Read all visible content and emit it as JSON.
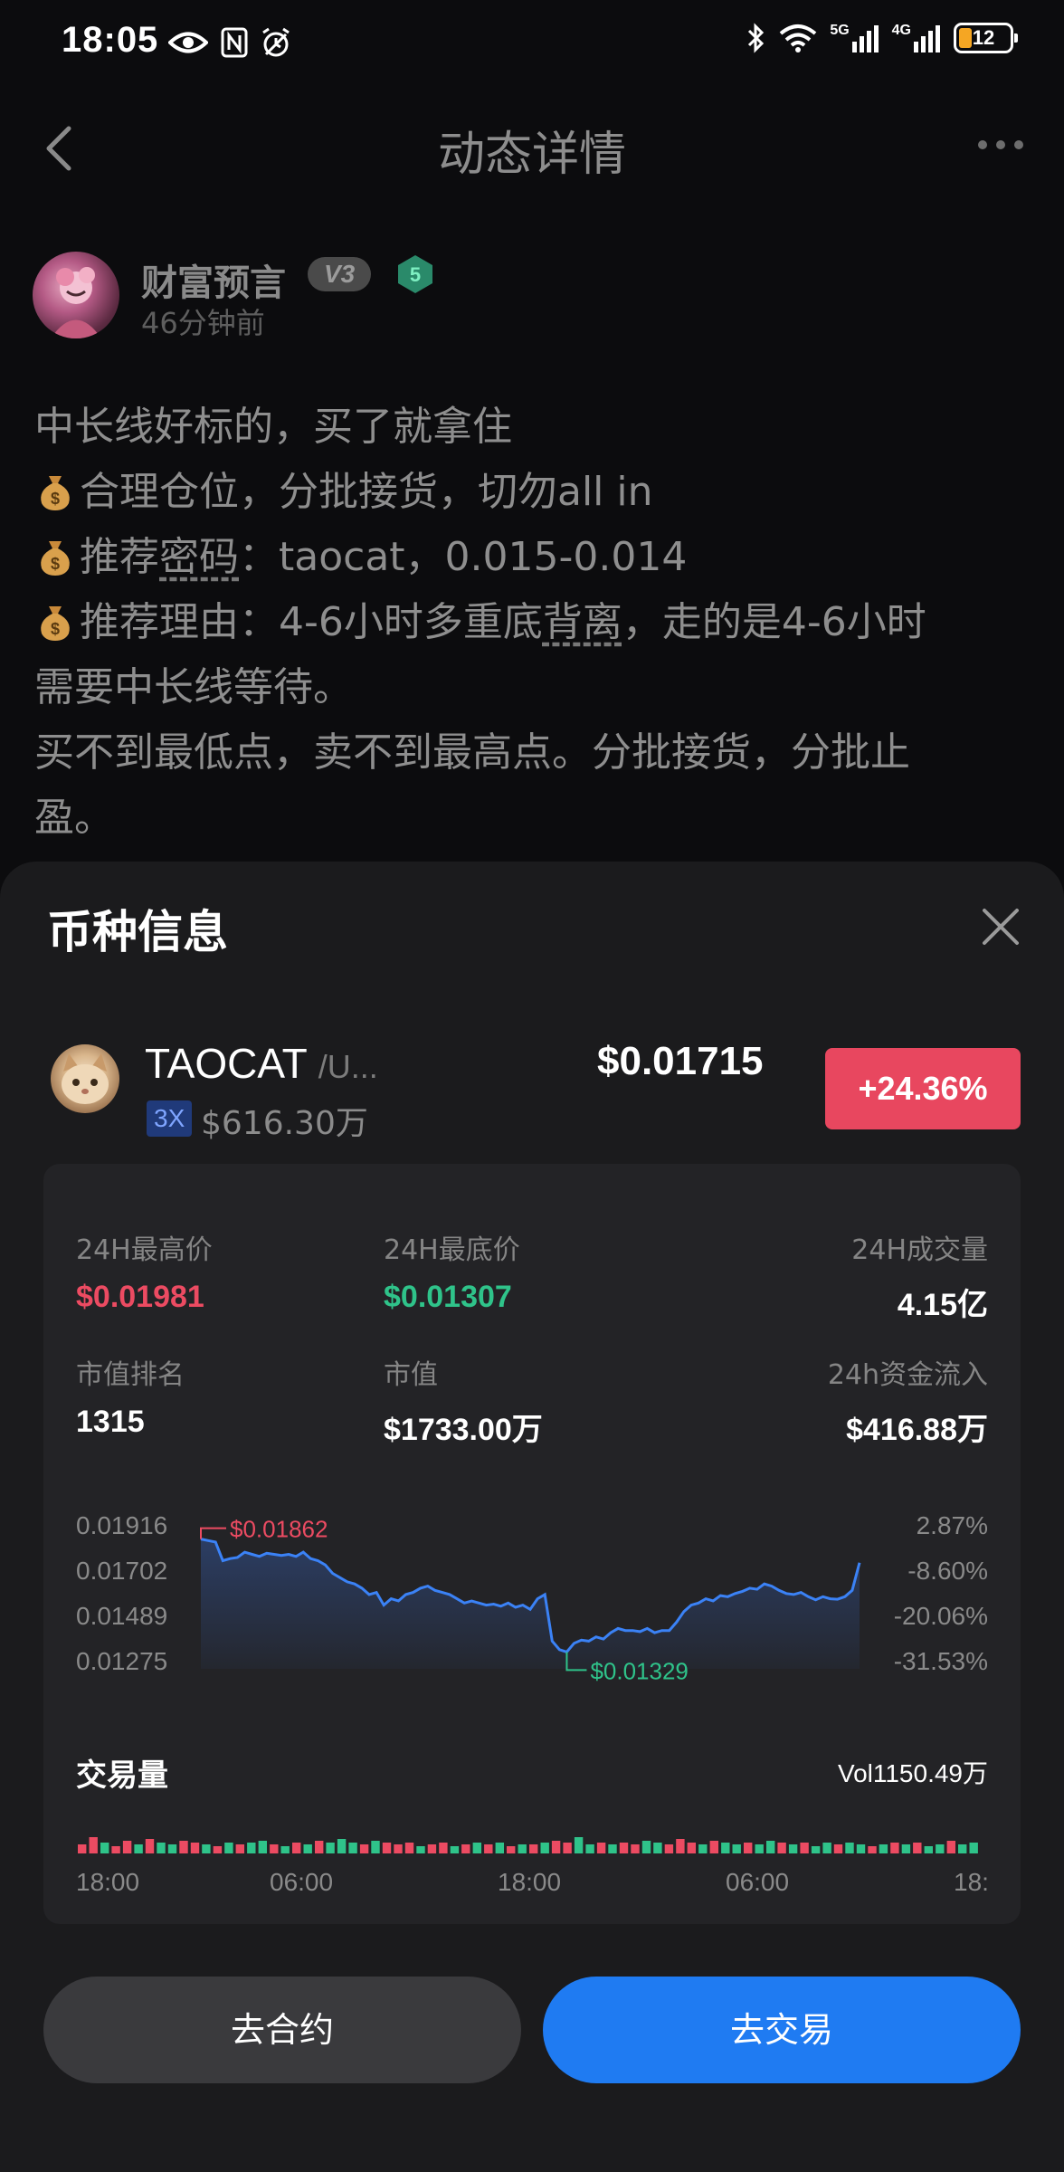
{
  "status_bar": {
    "time": "18:05",
    "net_5g": "5G",
    "net_4g": "4G",
    "battery": "12",
    "icons": [
      "eye-icon",
      "nfc-icon",
      "alarm-icon",
      "bluetooth-icon",
      "wifi-icon",
      "signal-icon",
      "battery-icon"
    ]
  },
  "header": {
    "title": "动态详情",
    "back_icon": "chevron-left-icon",
    "more_icon": "more-dots-icon"
  },
  "author": {
    "name": "财富预言",
    "vip_badge": "V3",
    "level": "5",
    "time": "46分钟前"
  },
  "post": {
    "line1": "中长线好标的，买了就拿住",
    "line2": "合理仓位，分批接货，切勿all in",
    "line3_a": "推荐",
    "line3_b": "密码",
    "line3_c": "：taocat，0.015-0.014",
    "line4_a": "推荐理由：4-6小时多重底",
    "line4_b": "背离",
    "line4_c": "，走的是4-6小时",
    "line5": "需要中长线等待。",
    "line6": "买不到最低点，卖不到最高点。分批接货，分批止",
    "line7": "盈。"
  },
  "sheet": {
    "title": "币种信息",
    "close_icon": "close-icon"
  },
  "coin": {
    "symbol": "TAOCAT",
    "pair": "/U...",
    "leverage": "3X",
    "volume": "$616.30万",
    "price": "$0.01715",
    "change": "+24.36%"
  },
  "stats": {
    "high_label": "24H最高价",
    "high_value": "$0.01981",
    "low_label": "24H最底价",
    "low_value": "$0.01307",
    "vol_label": "24H成交量",
    "vol_value": "4.15亿",
    "rank_label": "市值排名",
    "rank_value": "1315",
    "mcap_label": "市值",
    "mcap_value": "$1733.00万",
    "inflow_label": "24h资金流入",
    "inflow_value": "$416.88万"
  },
  "chart_data": {
    "type": "line",
    "y_ticks": [
      "0.01916",
      "0.01702",
      "0.01489",
      "0.01275"
    ],
    "pct_ticks": [
      "2.87%",
      "-8.60%",
      "-20.06%",
      "-31.53%"
    ],
    "x_ticks": [
      "18:00",
      "06:00",
      "18:00",
      "06:00",
      "18:"
    ],
    "ylim": [
      0.01275,
      0.01916
    ],
    "max_label": "$0.01862",
    "min_label": "$0.01329",
    "values": [
      0.01862,
      0.01855,
      0.01848,
      0.0176,
      0.0177,
      0.01775,
      0.018,
      0.0179,
      0.0178,
      0.01795,
      0.0179,
      0.01785,
      0.0179,
      0.0178,
      0.018,
      0.0177,
      0.0176,
      0.0174,
      0.017,
      0.0168,
      0.0166,
      0.0165,
      0.0163,
      0.016,
      0.0161,
      0.0155,
      0.0158,
      0.0157,
      0.016,
      0.0161,
      0.0163,
      0.0164,
      0.0162,
      0.0161,
      0.016,
      0.0158,
      0.0156,
      0.0157,
      0.0156,
      0.0155,
      0.01555,
      0.01545,
      0.0156,
      0.0154,
      0.0155,
      0.0153,
      0.0158,
      0.016,
      0.0138,
      0.0134,
      0.01329,
      0.0137,
      0.01385,
      0.0138,
      0.014,
      0.0139,
      0.0142,
      0.0144,
      0.0143,
      0.0143,
      0.01425,
      0.0144,
      0.0142,
      0.0143,
      0.0143,
      0.0147,
      0.0152,
      0.0155,
      0.0156,
      0.0158,
      0.0157,
      0.01595,
      0.0159,
      0.01605,
      0.01615,
      0.0163,
      0.01625,
      0.0165,
      0.0164,
      0.0162,
      0.01605,
      0.016,
      0.0161,
      0.0159,
      0.01575,
      0.0159,
      0.0158,
      0.01578,
      0.0159,
      0.0162,
      0.0175
    ]
  },
  "volume": {
    "title": "交易量",
    "total": "Vol1150.49万",
    "bars": [
      {
        "h": 0.5,
        "up": false
      },
      {
        "h": 0.9,
        "up": false
      },
      {
        "h": 0.6,
        "up": true
      },
      {
        "h": 0.4,
        "up": false
      },
      {
        "h": 0.7,
        "up": false
      },
      {
        "h": 0.5,
        "up": true
      },
      {
        "h": 0.8,
        "up": false
      },
      {
        "h": 0.6,
        "up": true
      },
      {
        "h": 0.5,
        "up": true
      },
      {
        "h": 0.7,
        "up": false
      },
      {
        "h": 0.6,
        "up": false
      },
      {
        "h": 0.5,
        "up": true
      },
      {
        "h": 0.4,
        "up": false
      },
      {
        "h": 0.6,
        "up": true
      },
      {
        "h": 0.5,
        "up": false
      },
      {
        "h": 0.6,
        "up": true
      },
      {
        "h": 0.7,
        "up": true
      },
      {
        "h": 0.5,
        "up": false
      },
      {
        "h": 0.4,
        "up": true
      },
      {
        "h": 0.6,
        "up": false
      },
      {
        "h": 0.5,
        "up": true
      },
      {
        "h": 0.7,
        "up": false
      },
      {
        "h": 0.6,
        "up": true
      },
      {
        "h": 0.8,
        "up": true
      },
      {
        "h": 0.6,
        "up": true
      },
      {
        "h": 0.5,
        "up": false
      },
      {
        "h": 0.7,
        "up": true
      },
      {
        "h": 0.6,
        "up": false
      },
      {
        "h": 0.5,
        "up": false
      },
      {
        "h": 0.6,
        "up": false
      },
      {
        "h": 0.4,
        "up": true
      },
      {
        "h": 0.5,
        "up": false
      },
      {
        "h": 0.6,
        "up": false
      },
      {
        "h": 0.4,
        "up": true
      },
      {
        "h": 0.5,
        "up": false
      },
      {
        "h": 0.6,
        "up": true
      },
      {
        "h": 0.5,
        "up": false
      },
      {
        "h": 0.6,
        "up": true
      },
      {
        "h": 0.4,
        "up": false
      },
      {
        "h": 0.5,
        "up": true
      },
      {
        "h": 0.5,
        "up": false
      },
      {
        "h": 0.6,
        "up": true
      },
      {
        "h": 0.7,
        "up": false
      },
      {
        "h": 0.6,
        "up": false
      },
      {
        "h": 0.9,
        "up": true
      },
      {
        "h": 0.5,
        "up": true
      },
      {
        "h": 0.6,
        "up": false
      },
      {
        "h": 0.5,
        "up": true
      },
      {
        "h": 0.6,
        "up": false
      },
      {
        "h": 0.5,
        "up": false
      },
      {
        "h": 0.7,
        "up": true
      },
      {
        "h": 0.6,
        "up": true
      },
      {
        "h": 0.5,
        "up": false
      },
      {
        "h": 0.8,
        "up": false
      },
      {
        "h": 0.6,
        "up": false
      },
      {
        "h": 0.5,
        "up": true
      },
      {
        "h": 0.7,
        "up": false
      },
      {
        "h": 0.6,
        "up": true
      },
      {
        "h": 0.5,
        "up": true
      },
      {
        "h": 0.6,
        "up": false
      },
      {
        "h": 0.5,
        "up": true
      },
      {
        "h": 0.7,
        "up": true
      },
      {
        "h": 0.6,
        "up": false
      },
      {
        "h": 0.5,
        "up": true
      },
      {
        "h": 0.6,
        "up": false
      },
      {
        "h": 0.4,
        "up": true
      },
      {
        "h": 0.6,
        "up": true
      },
      {
        "h": 0.5,
        "up": false
      },
      {
        "h": 0.6,
        "up": true
      },
      {
        "h": 0.5,
        "up": true
      },
      {
        "h": 0.4,
        "up": false
      },
      {
        "h": 0.5,
        "up": true
      },
      {
        "h": 0.6,
        "up": false
      },
      {
        "h": 0.5,
        "up": true
      },
      {
        "h": 0.6,
        "up": false
      },
      {
        "h": 0.4,
        "up": true
      },
      {
        "h": 0.5,
        "up": true
      },
      {
        "h": 0.7,
        "up": false
      },
      {
        "h": 0.5,
        "up": true
      },
      {
        "h": 0.6,
        "up": true
      }
    ]
  },
  "actions": {
    "contract_label": "去合约",
    "trade_label": "去交易"
  },
  "colors": {
    "up": "#2fc38a",
    "down": "#ec4b62",
    "line": "#3b82f6",
    "accent": "#1f7bf2"
  }
}
